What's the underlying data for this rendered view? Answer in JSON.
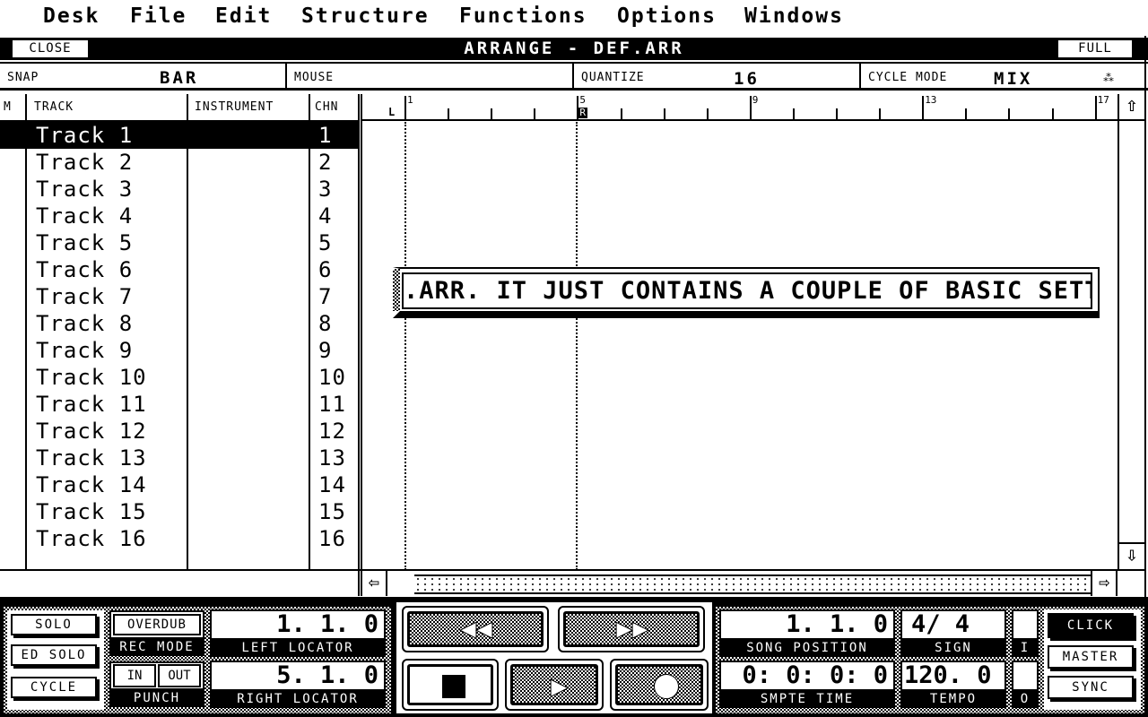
{
  "menu": [
    "Desk",
    "File",
    "Edit",
    "Structure",
    "Functions",
    "Options",
    "Windows"
  ],
  "window": {
    "title": "ARRANGE - DEF.ARR",
    "close": "CLOSE",
    "full": "FULL"
  },
  "info": {
    "snap_label": "SNAP",
    "snap_value": "BAR",
    "mouse_label": "MOUSE",
    "quantize_label": "QUANTIZE",
    "quantize_value": "16",
    "cycle_label": "CYCLE MODE",
    "cycle_value": "MIX"
  },
  "columns": {
    "m": "M",
    "track": "TRACK",
    "instrument": "INSTRUMENT",
    "chn": "CHN"
  },
  "tracks": [
    {
      "name": "Track 1",
      "chn": "1",
      "selected": true
    },
    {
      "name": "Track 2",
      "chn": "2"
    },
    {
      "name": "Track 3",
      "chn": "3"
    },
    {
      "name": "Track 4",
      "chn": "4"
    },
    {
      "name": "Track 5",
      "chn": "5"
    },
    {
      "name": "Track 6",
      "chn": "6"
    },
    {
      "name": "Track 7",
      "chn": "7"
    },
    {
      "name": "Track 8",
      "chn": "8"
    },
    {
      "name": "Track 9",
      "chn": "9"
    },
    {
      "name": "Track 10",
      "chn": "10"
    },
    {
      "name": "Track 11",
      "chn": "11"
    },
    {
      "name": "Track 12",
      "chn": "12"
    },
    {
      "name": "Track 13",
      "chn": "13"
    },
    {
      "name": "Track 14",
      "chn": "14"
    },
    {
      "name": "Track 15",
      "chn": "15"
    },
    {
      "name": "Track 16",
      "chn": "16"
    }
  ],
  "ruler": {
    "bars": [
      "1",
      "5",
      "9",
      "13",
      "17"
    ],
    "left_marker": "L",
    "right_marker": "R"
  },
  "message": ".ARR. IT JUST CONTAINS A COUPLE OF BASIC SETTING",
  "transport": {
    "solo": "SOLO",
    "ed_solo": "ED SOLO",
    "cycle": "CYCLE",
    "overdub": "OVERDUB",
    "rec_mode": "REC MODE",
    "punch_in": "IN",
    "punch_out": "OUT",
    "punch": "PUNCH",
    "left_locator": "1. 1.  0",
    "left_locator_label": "LEFT LOCATOR",
    "right_locator": "5. 1.  0",
    "right_locator_label": "RIGHT LOCATOR",
    "song_position": "1. 1.  0",
    "song_position_label": "SONG POSITION",
    "sign": "4/ 4",
    "sign_label": "SIGN",
    "smpte": "0: 0: 0: 0",
    "smpte_label": "SMPTE TIME",
    "tempo": "120.  0",
    "tempo_label": "TEMPO",
    "in_ind": "I",
    "out_ind": "O",
    "click": "CLICK",
    "master": "MASTER",
    "sync": "SYNC"
  }
}
